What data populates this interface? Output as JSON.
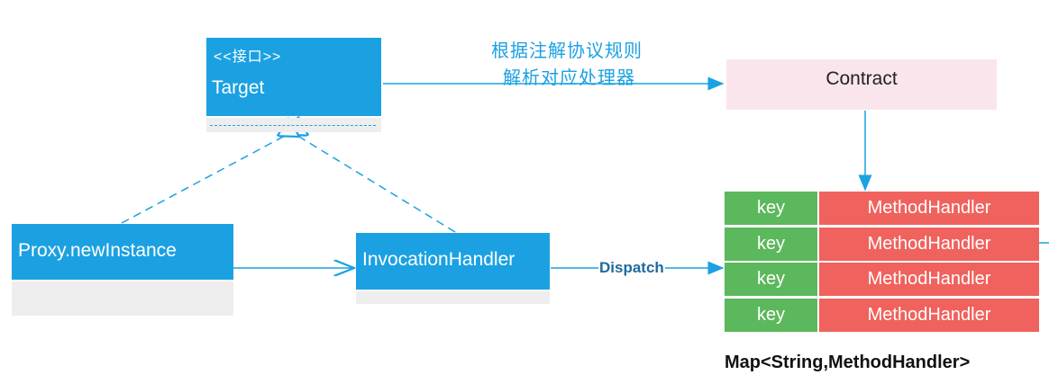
{
  "colors": {
    "blue": "#1ba1e2",
    "pink": "#fbe5ec",
    "green": "#5cb85c",
    "red": "#f0625d",
    "dispatch_text": "#1f6aa0"
  },
  "target": {
    "stereotype": "<<接口>>",
    "name": "Target"
  },
  "proxy": {
    "name": "Proxy.newInstance"
  },
  "invocation": {
    "name": "InvocationHandler"
  },
  "contract": {
    "name": "Contract"
  },
  "edges": {
    "target_contract_line1": "根据注解协议规则",
    "target_contract_line2": "解析对应处理器",
    "dispatch": "Dispatch"
  },
  "map": {
    "rows": [
      {
        "key": "key",
        "value": "MethodHandler"
      },
      {
        "key": "key",
        "value": "MethodHandler"
      },
      {
        "key": "key",
        "value": "MethodHandler"
      },
      {
        "key": "key",
        "value": "MethodHandler"
      }
    ],
    "caption": "Map<String,MethodHandler>"
  }
}
